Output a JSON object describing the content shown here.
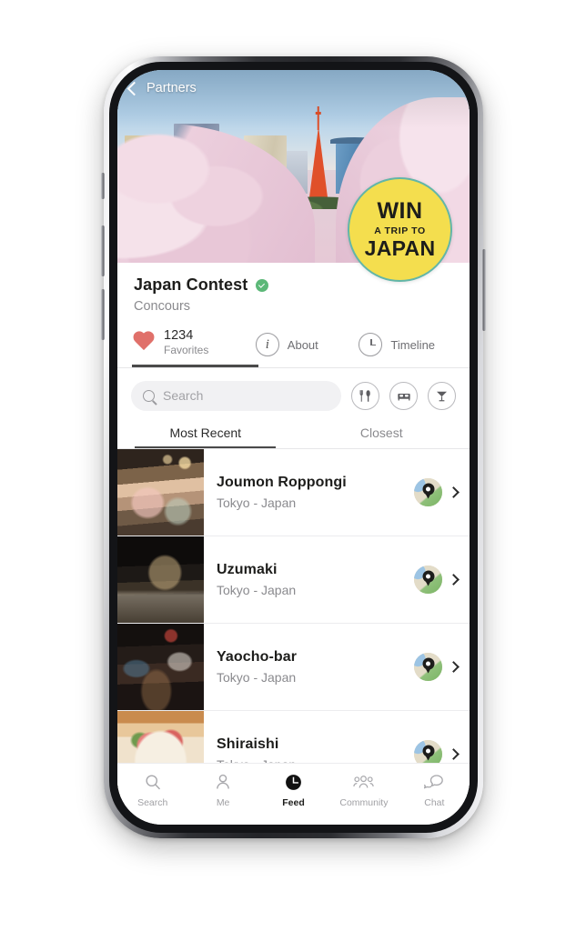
{
  "hero": {
    "back_label": "Partners",
    "back_icon": "chevron-left-icon",
    "badge": {
      "line1": "WIN",
      "line2": "A TRIP TO",
      "line3": "JAPAN",
      "fill_color": "#f4de4e",
      "ring_color": "#62b6a8"
    }
  },
  "profile": {
    "title": "Japan Contest",
    "verified_icon": "verified-check-icon",
    "subtitle": "Concours"
  },
  "stats": [
    {
      "icon": "heart-icon",
      "value": "1234",
      "label": "Favorites",
      "active": true,
      "color": "#e0706a"
    },
    {
      "icon": "info-icon",
      "label": "About",
      "active": false
    },
    {
      "icon": "clock-icon",
      "label": "Timeline",
      "active": false
    }
  ],
  "search": {
    "placeholder": "Search",
    "value": "",
    "icon": "search-icon"
  },
  "filters": [
    {
      "icon": "fork-knife-icon",
      "name": "restaurant"
    },
    {
      "icon": "bed-icon",
      "name": "hotel"
    },
    {
      "icon": "cocktail-icon",
      "name": "bar"
    }
  ],
  "sort_tabs": [
    {
      "label": "Most Recent",
      "active": true
    },
    {
      "label": "Closest",
      "active": false
    }
  ],
  "list": [
    {
      "title": "Joumon Roppongi",
      "subtitle": "Tokyo - Japan",
      "map_icon": "map-pin-icon",
      "chevron": "chevron-right-icon"
    },
    {
      "title": "Uzumaki",
      "subtitle": "Tokyo - Japan",
      "map_icon": "map-pin-icon",
      "chevron": "chevron-right-icon"
    },
    {
      "title": "Yaocho-bar",
      "subtitle": "Tokyo - Japan",
      "map_icon": "map-pin-icon",
      "chevron": "chevron-right-icon"
    },
    {
      "title": "Shiraishi",
      "subtitle": "Tokyo - Japan",
      "map_icon": "map-pin-icon",
      "chevron": "chevron-right-icon"
    }
  ],
  "bottom_nav": [
    {
      "label": "Search",
      "icon": "search-icon",
      "active": false
    },
    {
      "label": "Me",
      "icon": "person-icon",
      "active": false
    },
    {
      "label": "Feed",
      "icon": "clock-filled-icon",
      "active": true
    },
    {
      "label": "Community",
      "icon": "people-group-icon",
      "active": false
    },
    {
      "label": "Chat",
      "icon": "chat-bubbles-icon",
      "active": false
    }
  ]
}
